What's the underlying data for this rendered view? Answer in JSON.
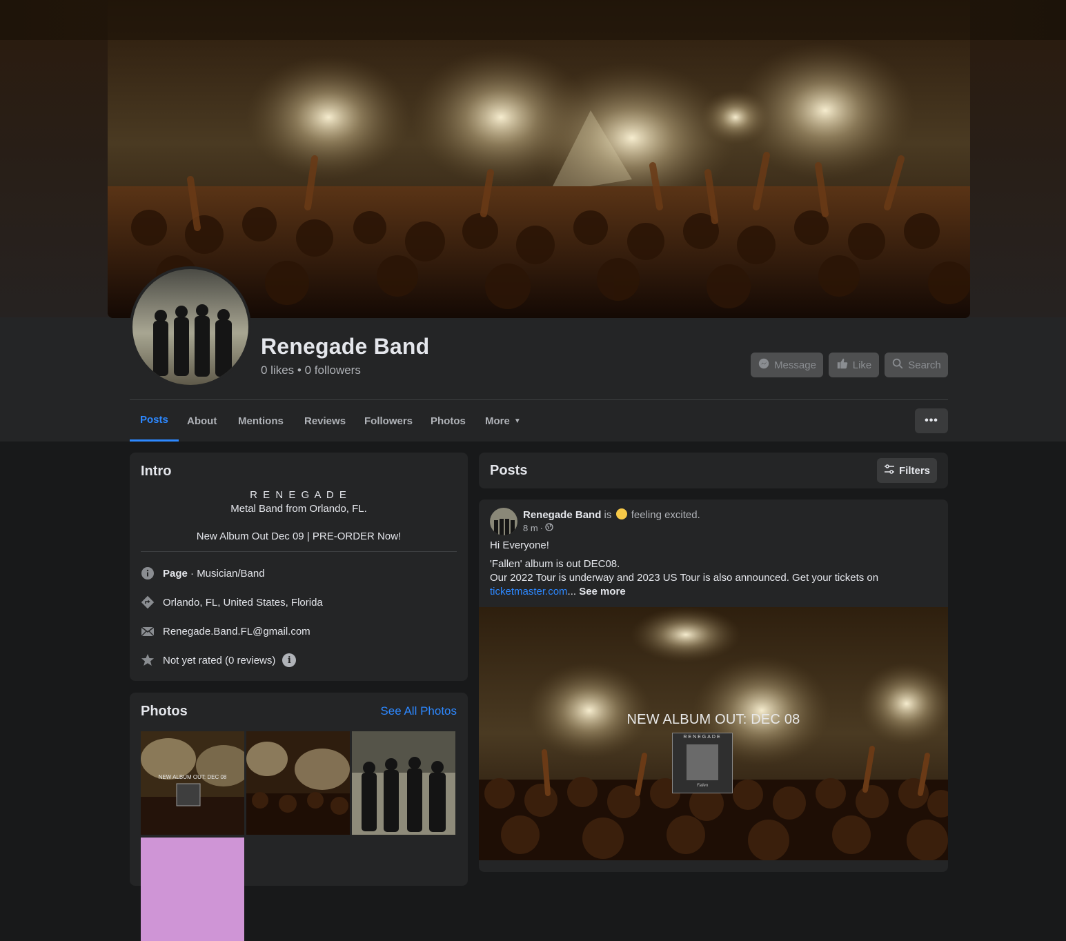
{
  "page": {
    "name": "Renegade Band",
    "stats": "0 likes • 0 followers"
  },
  "actions": {
    "message": "Message",
    "like": "Like",
    "search": "Search"
  },
  "tabs": [
    {
      "label": "Posts",
      "active": true
    },
    {
      "label": "About"
    },
    {
      "label": "Mentions"
    },
    {
      "label": "Reviews"
    },
    {
      "label": "Followers"
    },
    {
      "label": "Photos"
    },
    {
      "label": "More"
    }
  ],
  "more_dots": "•••",
  "intro": {
    "title": "Intro",
    "bio": [
      "R E N E G A D E",
      "Metal Band from Orlando, FL.",
      "New Album Out Dec 09 | PRE-ORDER Now!"
    ],
    "page_label": "Page",
    "category": " · Musician/Band",
    "location": "Orlando, FL, United States, Florida",
    "email": "Renegade.Band.FL@gmail.com",
    "rating": "Not yet rated (0 reviews)",
    "info_glyph": "i"
  },
  "photos": {
    "title": "Photos",
    "see_all": "See All Photos",
    "thumb_caption": "NEW ALBUM OUT: DEC 08"
  },
  "posts_header": {
    "title": "Posts",
    "filters": "Filters"
  },
  "post": {
    "author": "Renegade Band",
    "is": " is ",
    "feeling": "feeling excited.",
    "time": "8 m",
    "dot": " · ",
    "greeting": "Hi Everyone!",
    "line1": "'Fallen' album is out DEC08.",
    "line2": "Our 2022 Tour is underway and 2023 US Tour is also announced. Get your tickets on",
    "link": "ticketmaster.com",
    "ellipsis": "... ",
    "see_more": "See more",
    "image_caption_light": "NEW ALBUM OUT: ",
    "image_caption_bold": "DEC 08",
    "album_title": "RENEGADE",
    "album_sub": "Fallen"
  },
  "colors": {
    "accent": "#2d88ff",
    "background": "#18191a",
    "card": "#242526"
  },
  "icons": [
    "messenger-icon",
    "thumbs-up-icon",
    "search-icon",
    "info-icon",
    "location-icon",
    "mail-icon",
    "star-icon",
    "filters-icon",
    "globe-icon"
  ]
}
